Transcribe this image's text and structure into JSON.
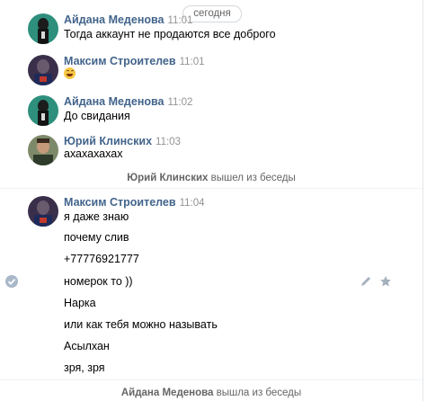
{
  "date_label": "сегодня",
  "messages": [
    {
      "author": "Айдана Меденова",
      "time": "11:01",
      "avatar": "green-avatar",
      "lines": [
        "Тогда аккаунт не продаются все доброго"
      ]
    },
    {
      "author": "Максим Строителев",
      "time": "11:01",
      "avatar": "dark-avatar",
      "lines": [],
      "emoji": "laughing-face-icon"
    },
    {
      "author": "Айдана Меденова",
      "time": "11:02",
      "avatar": "green-avatar",
      "lines": [
        "До свидания"
      ]
    },
    {
      "author": "Юрий Клинских",
      "time": "11:03",
      "avatar": "photo-avatar",
      "lines": [
        "ахахахахах"
      ]
    },
    {
      "author": "Максим Строителев",
      "time": "11:04",
      "avatar": "dark-avatar",
      "lines": [
        "я даже знаю",
        "почему слив",
        "+77776921777",
        "номерок то ))",
        "Нарка",
        "или как тебя можно называть",
        "Асылхан",
        "зря, зря"
      ]
    }
  ],
  "service_messages": [
    {
      "name": "Юрий Клинских",
      "text": "вышел из беседы"
    },
    {
      "name": "Айдана Меденова",
      "text": "вышла из беседы"
    }
  ],
  "actions": {
    "edit_icon": "pencil-icon",
    "favorite_icon": "star-icon",
    "selected_icon": "check-circle-icon"
  },
  "colors": {
    "author": "#42648b",
    "time": "#939393",
    "service": "#656565",
    "check": "#a9b8c9"
  }
}
